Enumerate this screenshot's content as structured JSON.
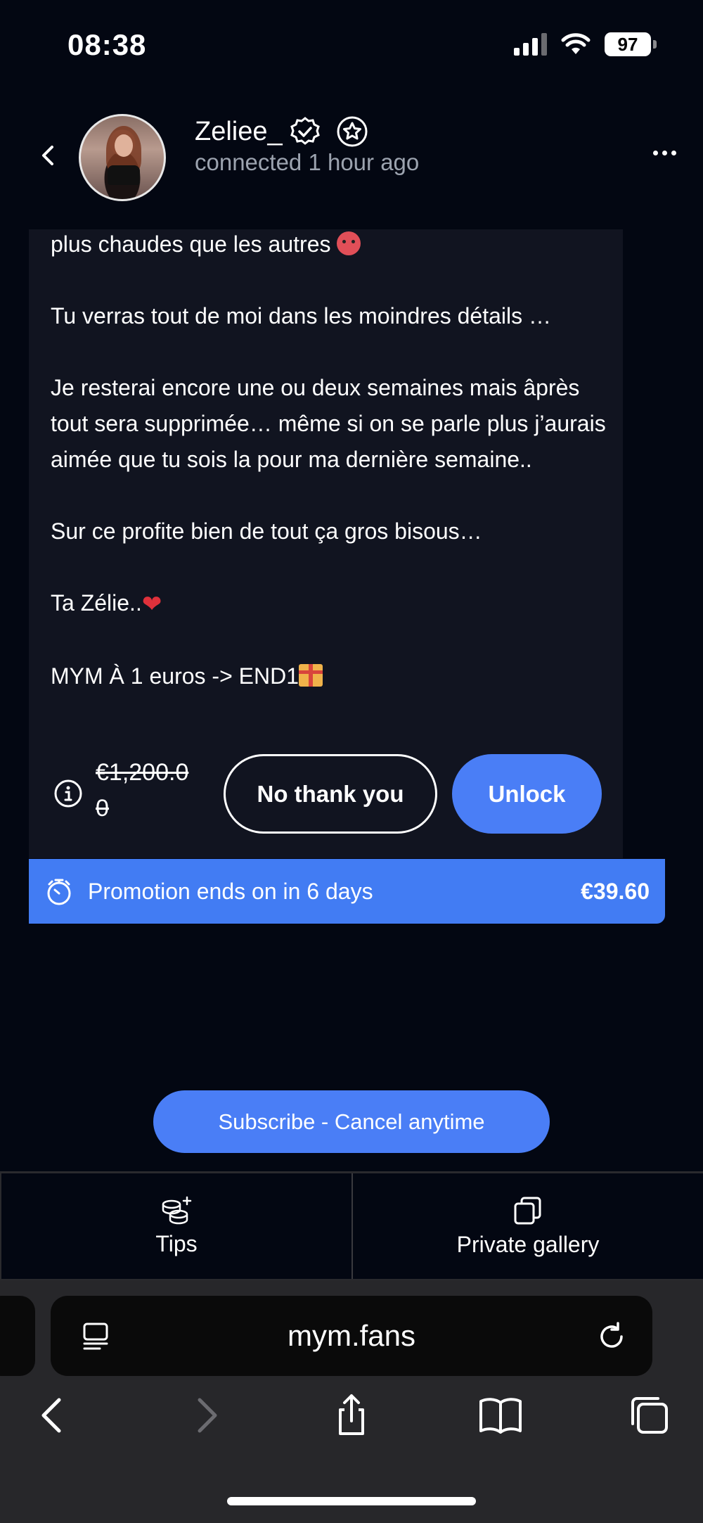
{
  "status_bar": {
    "time": "08:38",
    "battery": "97"
  },
  "header": {
    "username": "Zeliee_",
    "status": "connected 1 hour ago"
  },
  "message": {
    "paragraphs": [
      "plus chaudes que les autres",
      "Tu verras tout de moi dans les moindres détails …",
      "Je resterai encore une ou deux semaines mais âprès tout sera supprimée… même si on se parle plus j’aurais aimée que tu sois la pour ma dernière semaine..",
      "Sur ce profite bien de tout ça gros bisous…",
      "Ta Zélie..",
      "MYM À 1 euros -> END1"
    ],
    "old_price": "€1,200.00",
    "no_thanks_label": "No thank you",
    "unlock_label": "Unlock"
  },
  "promo": {
    "text": "Promotion ends on in 6 days",
    "price": "€39.60"
  },
  "subscribe_label": "Subscribe - Cancel anytime",
  "tabs": [
    {
      "label": "Tips",
      "icon": "coins-plus-icon"
    },
    {
      "label": "Private gallery",
      "icon": "gallery-icon"
    }
  ],
  "browser": {
    "url": "mym.fans"
  },
  "colors": {
    "background": "#030712",
    "card": "#111420",
    "accent": "#4a7ef6",
    "promo": "#427cf3",
    "muted_text": "#9ca3af"
  }
}
